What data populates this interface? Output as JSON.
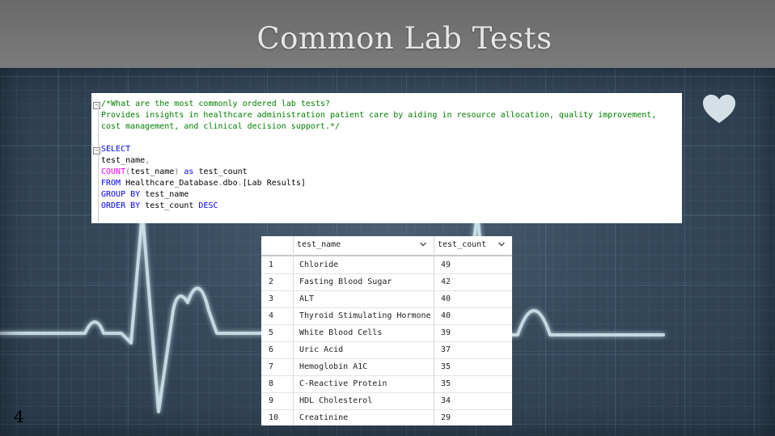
{
  "slide": {
    "title": "Common Lab Tests",
    "page_number": "4"
  },
  "editor": {
    "lines": [
      {
        "segments": [
          {
            "text": "/*What are the most commonly ordered lab tests?",
            "cls": "cm"
          }
        ]
      },
      {
        "segments": [
          {
            "text": "Provides insights in healthcare administration patient care by aiding in resource allocation, quality improvement,",
            "cls": "cm"
          }
        ]
      },
      {
        "segments": [
          {
            "text": "cost management, and clinical decision support.*/",
            "cls": "cm"
          }
        ]
      },
      {
        "segments": [
          {
            "text": "",
            "cls": ""
          }
        ]
      },
      {
        "segments": [
          {
            "text": "SELECT",
            "cls": "kw"
          }
        ]
      },
      {
        "segments": [
          {
            "text": "test_name",
            "cls": ""
          },
          {
            "text": ",",
            "cls": "gr"
          }
        ]
      },
      {
        "segments": [
          {
            "text": "COUNT",
            "cls": "fn"
          },
          {
            "text": "(",
            "cls": "gr"
          },
          {
            "text": "test_name",
            "cls": ""
          },
          {
            "text": ")",
            "cls": "gr"
          },
          {
            "text": " as ",
            "cls": "kw"
          },
          {
            "text": "test_count",
            "cls": ""
          }
        ]
      },
      {
        "segments": [
          {
            "text": "FROM ",
            "cls": "kw"
          },
          {
            "text": "Healthcare_Database",
            "cls": ""
          },
          {
            "text": ".",
            "cls": "gr"
          },
          {
            "text": "dbo",
            "cls": ""
          },
          {
            "text": ".",
            "cls": "gr"
          },
          {
            "text": "[Lab Results]",
            "cls": ""
          }
        ]
      },
      {
        "segments": [
          {
            "text": "GROUP BY ",
            "cls": "kw"
          },
          {
            "text": "test_name",
            "cls": ""
          }
        ]
      },
      {
        "segments": [
          {
            "text": "ORDER BY ",
            "cls": "kw"
          },
          {
            "text": "test_count ",
            "cls": ""
          },
          {
            "text": "DESC",
            "cls": "kw"
          }
        ]
      }
    ]
  },
  "results": {
    "columns": [
      "test_name",
      "test_count"
    ],
    "rows": [
      {
        "n": "1",
        "name": "Chloride",
        "count": "49"
      },
      {
        "n": "2",
        "name": "Fasting Blood Sugar",
        "count": "42"
      },
      {
        "n": "3",
        "name": "ALT",
        "count": "40"
      },
      {
        "n": "4",
        "name": "Thyroid Stimulating Hormone",
        "count": "40"
      },
      {
        "n": "5",
        "name": "White Blood Cells",
        "count": "39"
      },
      {
        "n": "6",
        "name": "Uric Acid",
        "count": "37"
      },
      {
        "n": "7",
        "name": "Hemoglobin A1C",
        "count": "35"
      },
      {
        "n": "8",
        "name": "C-Reactive Protein",
        "count": "35"
      },
      {
        "n": "9",
        "name": "HDL Cholesterol",
        "count": "34"
      },
      {
        "n": "10",
        "name": "Creatinine",
        "count": "29"
      }
    ]
  },
  "icons": {
    "heart": "heart-icon",
    "sort": "chevron-down-icon",
    "collapse": "collapse-minus-icon"
  }
}
